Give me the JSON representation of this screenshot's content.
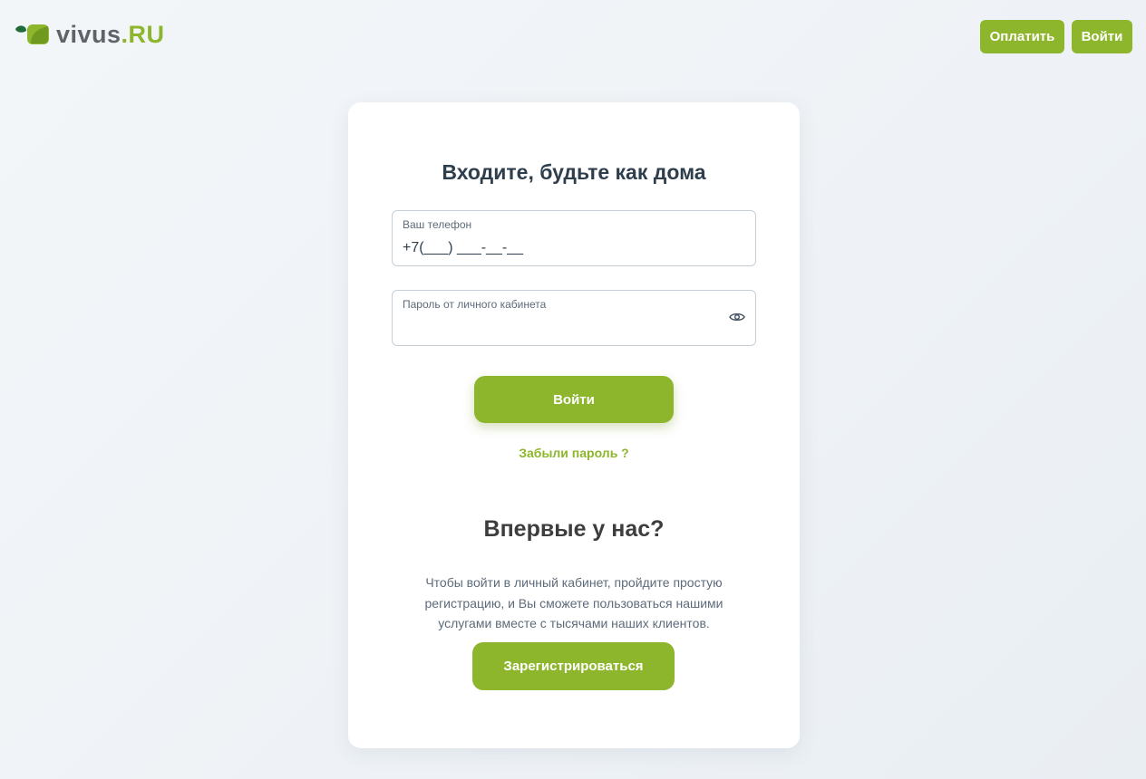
{
  "header": {
    "logo_main": "vivus",
    "logo_domain": ".RU",
    "pay_label": "Оплатить",
    "login_label": "Войти"
  },
  "login_form": {
    "title": "Входите, будьте как дома",
    "phone": {
      "label": "Ваш телефон",
      "value": "+7(___) ___-__-__"
    },
    "password": {
      "label": "Пароль от личного кабинета",
      "value": ""
    },
    "submit_label": "Войти",
    "forgot_label": "Забыли пароль ?"
  },
  "register": {
    "title": "Впервые у нас?",
    "description": "Чтобы войти в личный кабинет, пройдите простую регистрацию, и Вы сможете пользоваться нашими услугами вместе с тысячами наших клиентов.",
    "button_label": "Зарегистрироваться"
  },
  "icons": {
    "logo": "leaf-logo-icon",
    "password_toggle": "eye-icon"
  },
  "colors": {
    "accent": "#8db62c",
    "title": "#2f3e4d",
    "text_muted": "#5d6b7a",
    "logo_gray": "#5f6468",
    "logo_dark_green": "#1f6b3a"
  }
}
